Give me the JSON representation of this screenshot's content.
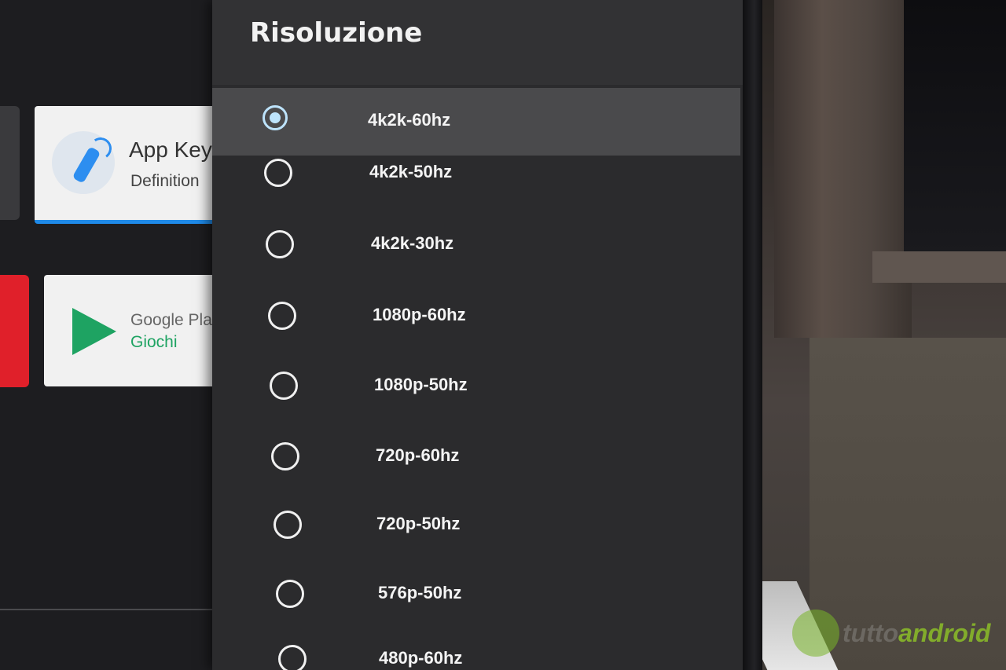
{
  "settings_panel": {
    "title": "Risoluzione",
    "options": [
      {
        "label": "4k2k-60hz",
        "selected": true
      },
      {
        "label": "4k2k-50hz",
        "selected": false
      },
      {
        "label": "4k2k-30hz",
        "selected": false
      },
      {
        "label": "1080p-60hz",
        "selected": false
      },
      {
        "label": "1080p-50hz",
        "selected": false
      },
      {
        "label": "720p-60hz",
        "selected": false
      },
      {
        "label": "720p-50hz",
        "selected": false
      },
      {
        "label": "576p-50hz",
        "selected": false
      },
      {
        "label": "480p-60hz",
        "selected": false
      }
    ]
  },
  "background_apps": {
    "app_key_definition": {
      "title": "App Key",
      "subtitle": "Definition"
    },
    "google_play_games": {
      "title": "Google Play",
      "subtitle": "Giochi"
    }
  },
  "watermark": {
    "prefix": "tutto",
    "text": "android"
  },
  "colors": {
    "panel_bg": "#2b2b2d",
    "selected_row_bg": "#4a4a4c",
    "radio_checked": "#bde3fb",
    "accent_blue": "#1f8ae8",
    "play_green": "#1ea362"
  }
}
